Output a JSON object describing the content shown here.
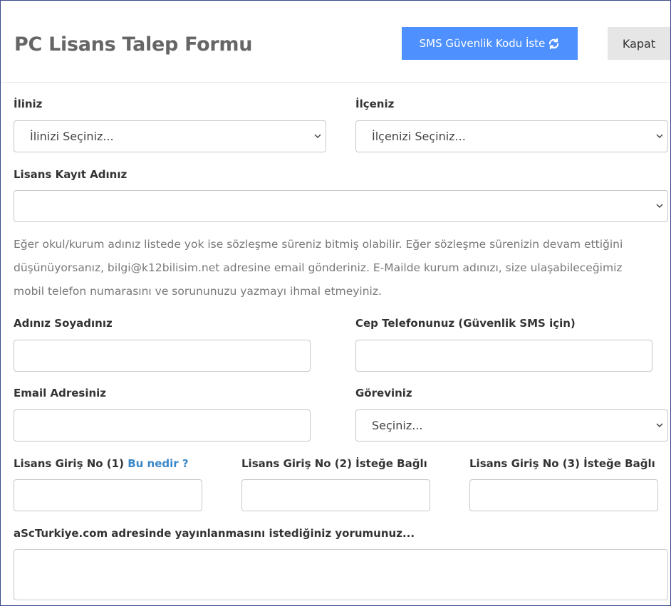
{
  "header": {
    "title": "PC Lisans Talep Formu",
    "sms_button_label": "SMS Güvenlik Kodu İste",
    "close_button_label": "Kapat"
  },
  "form": {
    "province": {
      "label": "İliniz",
      "value": "İlinizi Seçiniz..."
    },
    "district": {
      "label": "İlçeniz",
      "value": "İlçenizi Seçiniz..."
    },
    "license_name": {
      "label": "Lisans Kayıt Adınız",
      "value": ""
    },
    "help_text": "Eğer okul/kurum adınız listede yok ise sözleşme süreniz bitmiş olabilir. Eğer sözleşme sürenizin devam ettiğini düşünüyorsanız, bilgi@k12bilisim.net adresine email gönderiniz. E-Mailde kurum adınızı, size ulaşabileceğimiz mobil telefon numarasını ve sorununuzu yazmayı ihmal etmeyiniz.",
    "full_name": {
      "label": "Adınız Soyadınız",
      "value": ""
    },
    "phone": {
      "label": "Cep Telefonunuz (Güvenlik SMS için)",
      "value": ""
    },
    "email": {
      "label": "Email Adresiniz",
      "value": ""
    },
    "role": {
      "label": "Göreviniz",
      "value": "Seçiniz..."
    },
    "license_no_1": {
      "label": "Lisans Giriş No (1)",
      "link": "Bu nedir ?",
      "value": ""
    },
    "license_no_2": {
      "label": "Lisans Giriş No (2) İsteğe Bağlı",
      "value": ""
    },
    "license_no_3": {
      "label": "Lisans Giriş No (3) İsteğe Bağlı",
      "value": ""
    },
    "comment": {
      "label": "aScTurkiye.com adresinde yayınlanmasını istediğiniz yorumunuz...",
      "value": ""
    }
  },
  "colors": {
    "primary_button": "#4d90fe",
    "secondary_button": "#e6e6e6",
    "link": "#3a87c8",
    "title_text": "#666666",
    "help_text": "#777777"
  },
  "icons": {
    "sms_button": "refresh-icon",
    "select": "chevron-down-icon"
  }
}
